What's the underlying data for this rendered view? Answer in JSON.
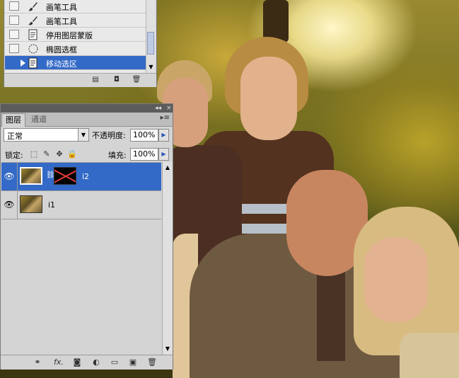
{
  "history": {
    "items": [
      {
        "label": "画笔工具",
        "icon": "brush-icon",
        "selected": false
      },
      {
        "label": "画笔工具",
        "icon": "brush-icon",
        "selected": false
      },
      {
        "label": "停用图层蒙版",
        "icon": "layer-mask-icon",
        "selected": false
      },
      {
        "label": "椭圆选框",
        "icon": "elliptical-marquee-icon",
        "selected": false
      },
      {
        "label": "移动选区",
        "icon": "move-selection-icon",
        "selected": true
      }
    ],
    "footer_icons": [
      "new-document-from-state-icon",
      "new-snapshot-icon",
      "delete-state-icon"
    ]
  },
  "layers_panel": {
    "titlebar": {
      "collapse": "◂◂",
      "close": "×"
    },
    "tabs": [
      {
        "label": "图层",
        "active": true
      },
      {
        "label": "通道",
        "active": false
      }
    ],
    "blend_mode": "正常",
    "opacity_label": "不透明度:",
    "opacity_value": "100%",
    "lock_label": "锁定:",
    "fill_label": "填充:",
    "fill_value": "100%",
    "layers": [
      {
        "name": "i2",
        "visible": true,
        "selected": true,
        "has_mask": true
      },
      {
        "name": "i1",
        "visible": true,
        "selected": false,
        "has_mask": false
      }
    ],
    "footer_icons": [
      "link-layers-icon",
      "fx-icon",
      "add-mask-icon",
      "adjustment-layer-icon",
      "new-group-icon",
      "new-layer-icon",
      "delete-layer-icon"
    ],
    "footer_glyphs": {
      "link": "⚭",
      "fx": "fx.",
      "mask": "◙",
      "adjust": "◐",
      "group": "▭",
      "new": "▣",
      "delete": "🗑"
    }
  },
  "colors": {
    "selection": "#3369c7",
    "panel_bg": "#d4d4d4",
    "titlebar": "#5c5c5c"
  }
}
